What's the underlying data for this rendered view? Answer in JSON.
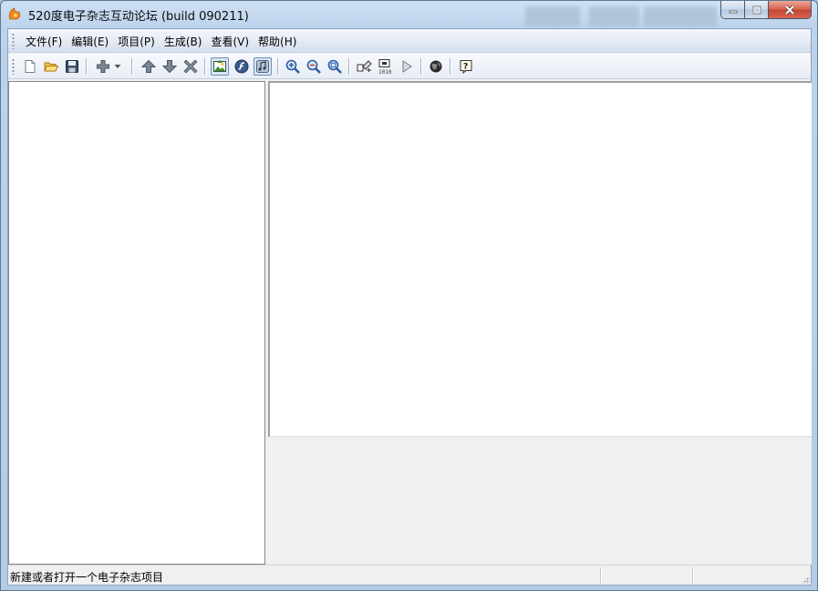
{
  "window": {
    "title": "520度电子杂志互动论坛 (build 090211)"
  },
  "menu": {
    "items": [
      {
        "label": "文件(F)",
        "name": "menu-file"
      },
      {
        "label": "编辑(E)",
        "name": "menu-edit"
      },
      {
        "label": "项目(P)",
        "name": "menu-project"
      },
      {
        "label": "生成(B)",
        "name": "menu-build"
      },
      {
        "label": "查看(V)",
        "name": "menu-view"
      },
      {
        "label": "帮助(H)",
        "name": "menu-help"
      }
    ]
  },
  "toolbar": {
    "buttons": [
      {
        "icon": "new-file-icon"
      },
      {
        "icon": "open-folder-icon"
      },
      {
        "icon": "save-icon"
      },
      {
        "icon": "add-icon"
      },
      {
        "icon": "dropdown-arrow-icon"
      },
      {
        "icon": "move-up-icon"
      },
      {
        "icon": "move-down-icon"
      },
      {
        "icon": "delete-icon"
      },
      {
        "icon": "picture-icon",
        "checked": true
      },
      {
        "icon": "flash-icon"
      },
      {
        "icon": "music-icon",
        "checked": true
      },
      {
        "icon": "zoom-in-icon"
      },
      {
        "icon": "zoom-out-icon"
      },
      {
        "icon": "zoom-fit-icon"
      },
      {
        "icon": "build-icon"
      },
      {
        "icon": "build-exe-icon"
      },
      {
        "icon": "play-icon"
      },
      {
        "icon": "globe-icon"
      },
      {
        "icon": "help-icon"
      }
    ]
  },
  "status": {
    "message": "新建或者打开一个电子杂志项目"
  },
  "colors": {
    "accent": "#3a6ea5",
    "close_button": "#c44434",
    "title_bar": "#bcd3ec"
  }
}
